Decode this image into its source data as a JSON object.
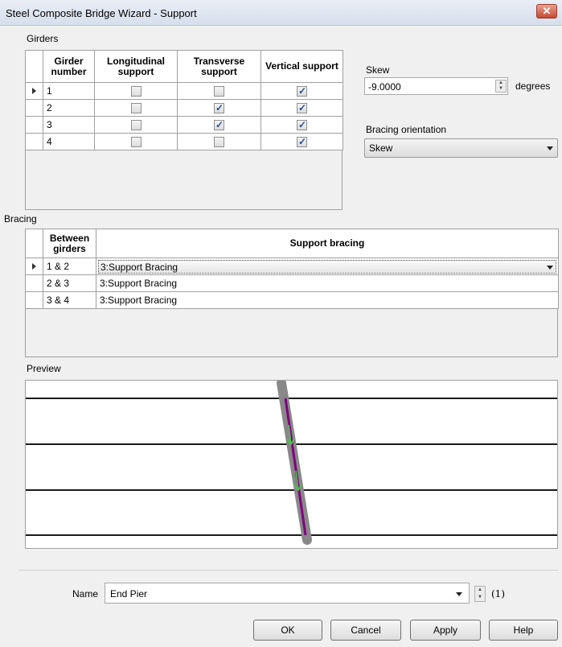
{
  "window": {
    "title": "Steel Composite Bridge Wizard - Support",
    "close_icon": "close-icon"
  },
  "girders": {
    "label": "Girders",
    "columns": [
      "Girder number",
      "Longitudinal support",
      "Transverse support",
      "Vertical support"
    ],
    "rows": [
      {
        "number": "1",
        "longitudinal": false,
        "transverse": false,
        "vertical": true
      },
      {
        "number": "2",
        "longitudinal": false,
        "transverse": true,
        "vertical": true
      },
      {
        "number": "3",
        "longitudinal": false,
        "transverse": true,
        "vertical": true
      },
      {
        "number": "4",
        "longitudinal": false,
        "transverse": false,
        "vertical": true
      }
    ]
  },
  "skew": {
    "label": "Skew",
    "value": "-9.0000",
    "unit": "degrees"
  },
  "bracing_orientation": {
    "label": "Bracing orientation",
    "value": "Skew"
  },
  "bracing": {
    "label": "Bracing",
    "columns": [
      "Between girders",
      "Support bracing"
    ],
    "rows": [
      {
        "between": "1 & 2",
        "support": "3:Support Bracing"
      },
      {
        "between": "2 & 3",
        "support": "3:Support Bracing"
      },
      {
        "between": "3 & 4",
        "support": "3:Support Bracing"
      }
    ]
  },
  "preview": {
    "label": "Preview",
    "colors": {
      "girder": "#1a1a1a",
      "support": "#888888",
      "bracing": "#800080",
      "arrows": "#44cc44"
    }
  },
  "name_field": {
    "label": "Name",
    "value": "End Pier",
    "counter": "(1)"
  },
  "buttons": {
    "ok": "OK",
    "cancel": "Cancel",
    "apply": "Apply",
    "help": "Help"
  }
}
